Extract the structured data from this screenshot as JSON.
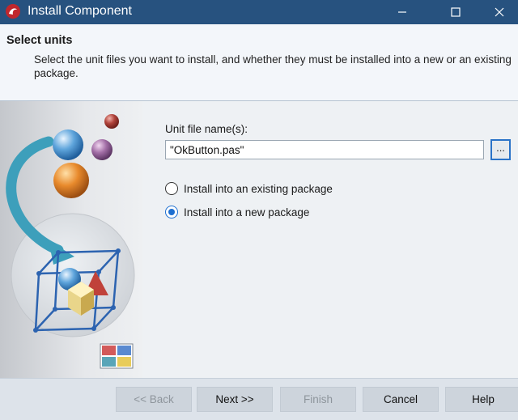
{
  "window": {
    "title": "Install Component"
  },
  "header": {
    "title": "Select units",
    "description": "Select the unit files you want to install, and whether they must be installed into a new or an existing package."
  },
  "form": {
    "unit_label": "Unit file name(s):",
    "unit_value": "\"OkButton.pas\"",
    "browse_label": "...",
    "options": [
      {
        "label": "Install into an existing package",
        "selected": false
      },
      {
        "label": "Install into a new package",
        "selected": true
      }
    ]
  },
  "footer": {
    "back": "<< Back",
    "next": "Next >>",
    "finish": "Finish",
    "cancel": "Cancel",
    "help": "Help"
  },
  "colors": {
    "titlebar": "#27527f",
    "accent": "#1e6fd0"
  }
}
